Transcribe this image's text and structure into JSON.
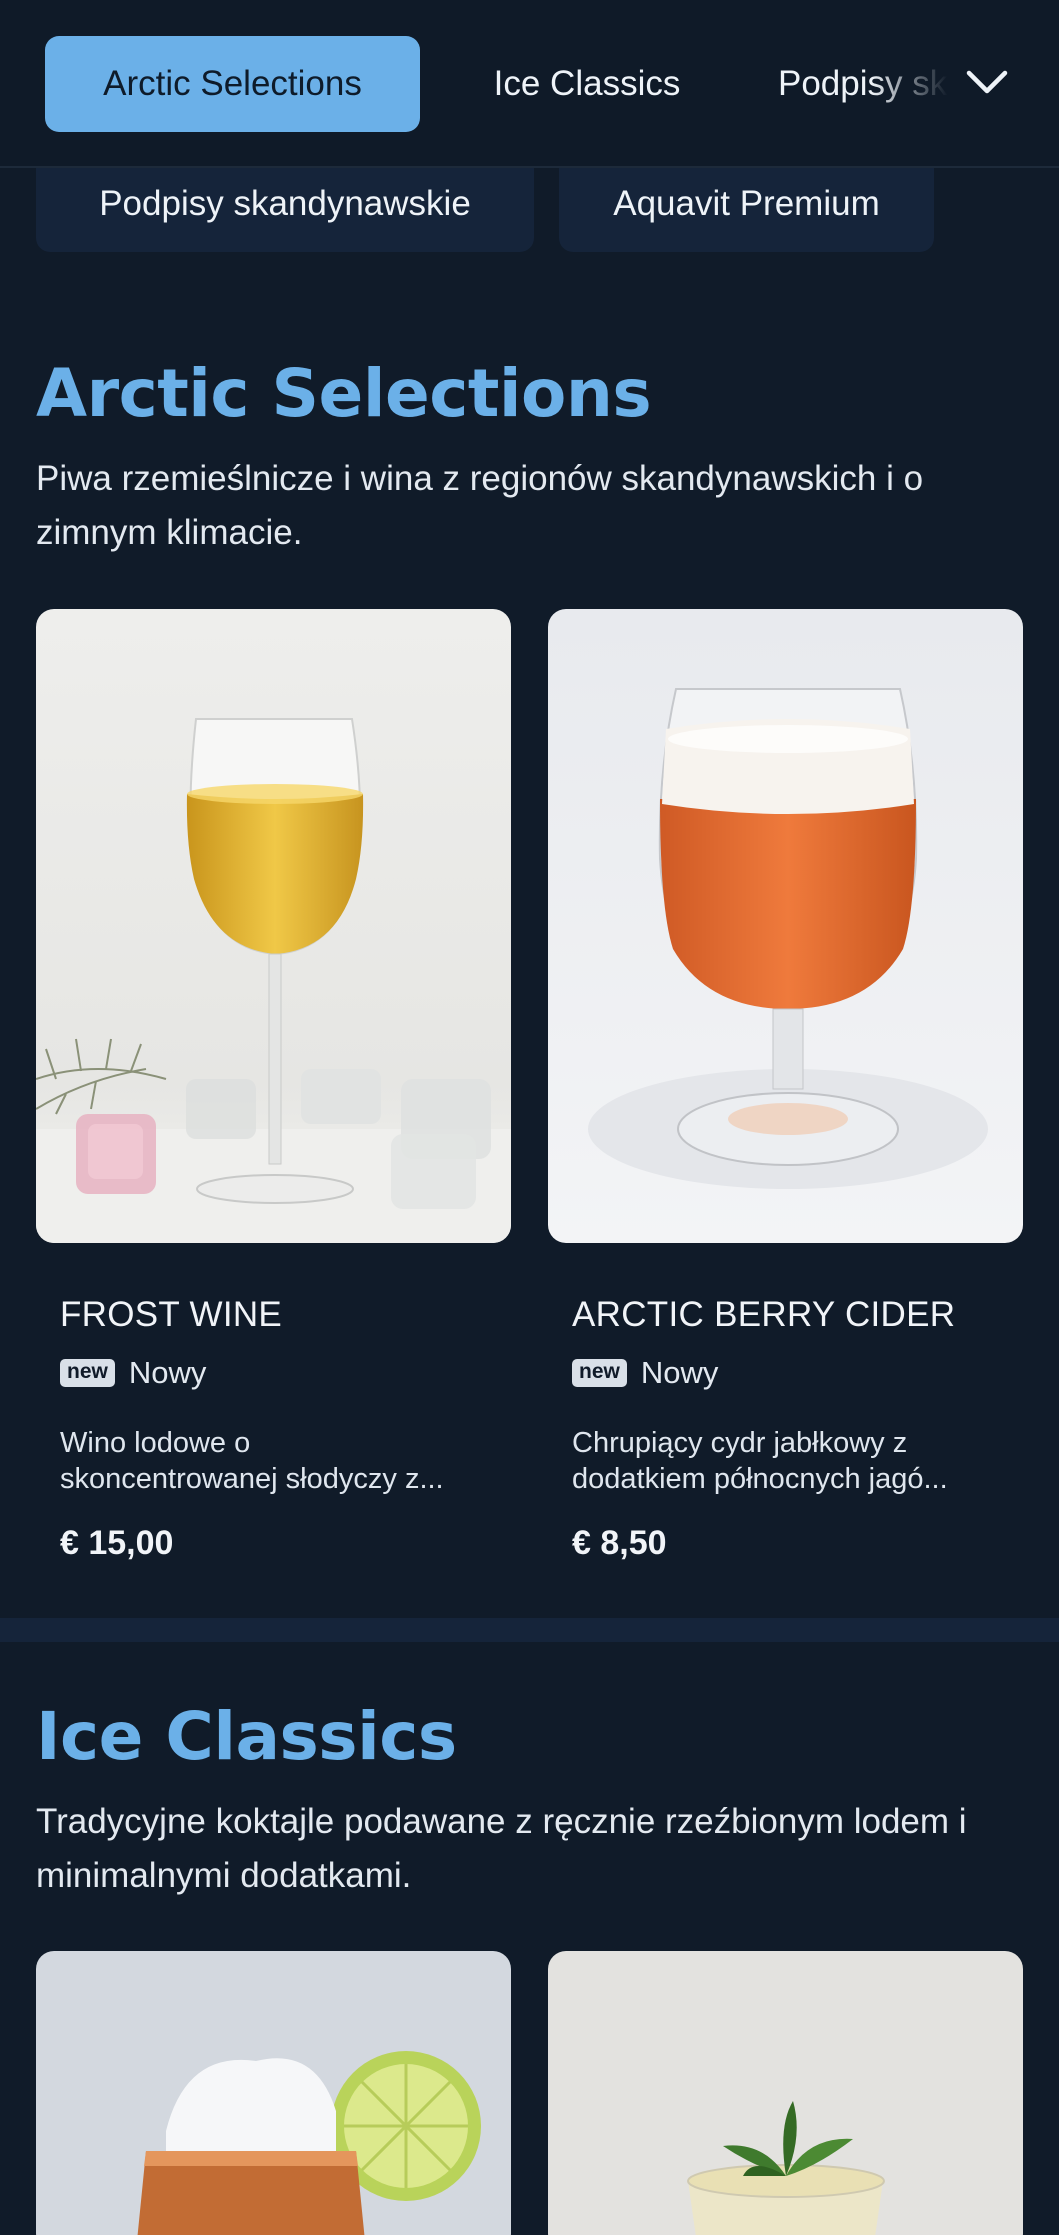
{
  "nav": {
    "tabs": [
      {
        "label": "Arctic Selections",
        "active": true
      },
      {
        "label": "Ice Classics",
        "active": false
      },
      {
        "label": "Podpisy skandynawskie",
        "active": false
      }
    ],
    "more_icon": "chevron-down-icon"
  },
  "chips": [
    {
      "label": "Podpisy skandynawskie"
    },
    {
      "label": "Aquavit Premium"
    }
  ],
  "sections": [
    {
      "title": "Arctic Selections",
      "description": "Piwa rzemieślnicze i wina z regionów skandynawskich i o zimnym klimacie.",
      "items": [
        {
          "name": "FROST WINE",
          "badge": "new",
          "badge_label": "Nowy",
          "description_line1": "Wino lodowe o",
          "description_line2": "skoncentrowanej słodyczy z...",
          "price": "€ 15,00"
        },
        {
          "name": "ARCTIC BERRY CIDER",
          "badge": "new",
          "badge_label": "Nowy",
          "description_line1": "Chrupiący cydr jabłkowy z",
          "description_line2": "dodatkiem północnych jagó...",
          "price": "€ 8,50"
        }
      ]
    },
    {
      "title": "Ice Classics",
      "description": "Tradycyjne koktajle podawane z ręcznie rzeźbionym lodem i minimalnymi dodatkami."
    }
  ],
  "colors": {
    "background": "#101b29",
    "accent": "#6bb0e8",
    "chip": "#15243a"
  }
}
